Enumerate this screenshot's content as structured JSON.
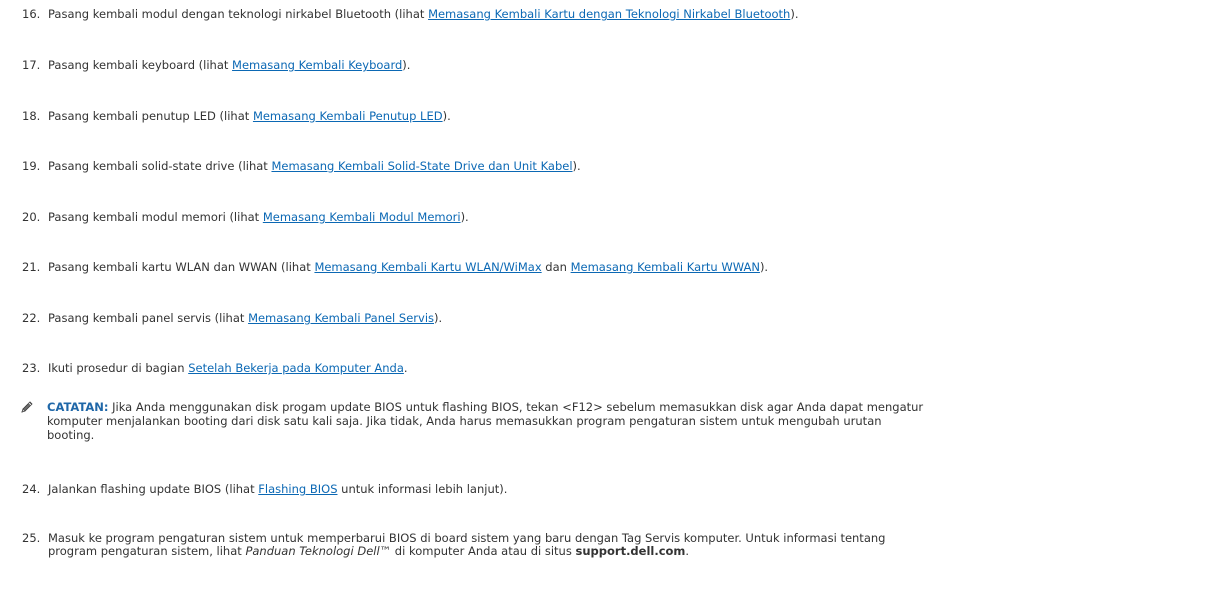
{
  "steps": [
    {
      "num": "16.",
      "pre": "Pasang kembali modul dengan teknologi nirkabel Bluetooth (lihat ",
      "link": "Memasang Kembali Kartu dengan Teknologi Nirkabel Bluetooth",
      "post": ")."
    },
    {
      "num": "17.",
      "pre": "Pasang kembali keyboard (lihat ",
      "link": "Memasang Kembali Keyboard",
      "post": ")."
    },
    {
      "num": "18.",
      "pre": "Pasang kembali penutup LED (lihat ",
      "link": "Memasang Kembali Penutup LED",
      "post": ")."
    },
    {
      "num": "19.",
      "pre": "Pasang kembali solid-state drive (lihat ",
      "link": "Memasang Kembali Solid-State Drive dan Unit Kabel",
      "post": ")."
    },
    {
      "num": "20.",
      "pre": "Pasang kembali modul memori (lihat ",
      "link": "Memasang Kembali Modul Memori",
      "post": ")."
    },
    {
      "num": "21.",
      "pre": "Pasang kembali kartu WLAN dan WWAN (lihat ",
      "link": "Memasang Kembali Kartu WLAN/WiMax",
      "mid": " dan ",
      "link2": "Memasang Kembali Kartu WWAN",
      "post": ")."
    },
    {
      "num": "22.",
      "pre": "Pasang kembali panel servis (lihat ",
      "link": "Memasang Kembali Panel Servis",
      "post": ")."
    },
    {
      "num": "23.",
      "pre": "Ikuti prosedur di bagian ",
      "link": "Setelah Bekerja pada Komputer Anda",
      "post": "."
    }
  ],
  "note": {
    "icon": "pencil-note-icon",
    "label": "CATATAN:",
    "text": " Jika Anda menggunakan disk progam update BIOS untuk flashing BIOS, tekan <F12> sebelum memasukkan disk agar Anda dapat mengatur",
    "line2": "komputer menjalankan booting dari disk satu kali saja. Jika tidak, Anda harus memasukkan program pengaturan sistem untuk mengubah urutan",
    "line3": "booting."
  },
  "step24": {
    "num": "24.",
    "pre": "Jalankan flashing update BIOS (lihat ",
    "link": "Flashing BIOS",
    "post": " untuk informasi lebih lanjut)."
  },
  "step25": {
    "num": "25.",
    "line1": "Masuk ke program pengaturan sistem untuk memperbarui BIOS di board sistem yang baru dengan Tag Servis komputer. Untuk informasi tentang",
    "line2_pre": "program pengaturan sistem, lihat ",
    "line2_italic": "Panduan Teknologi Dell™",
    "line2_mid": " di komputer Anda atau di situs ",
    "line2_bold": "support.dell.com",
    "line2_post": "."
  },
  "colors": {
    "link": "#0b68b4",
    "note_label": "#1f67a8",
    "text": "#333333"
  }
}
